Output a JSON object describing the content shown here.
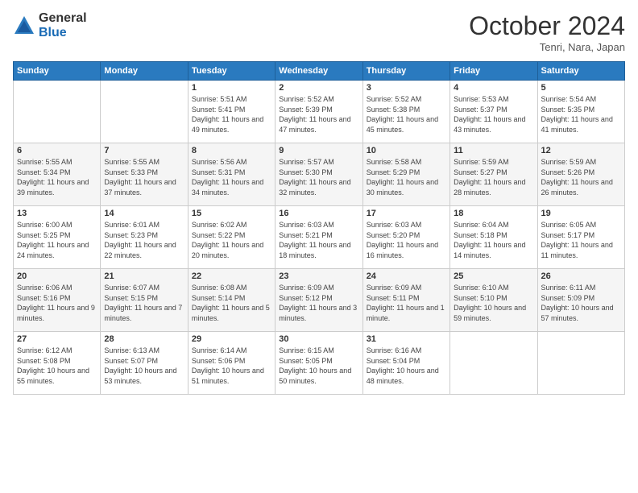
{
  "logo": {
    "general": "General",
    "blue": "Blue"
  },
  "header": {
    "month": "October 2024",
    "location": "Tenri, Nara, Japan"
  },
  "weekdays": [
    "Sunday",
    "Monday",
    "Tuesday",
    "Wednesday",
    "Thursday",
    "Friday",
    "Saturday"
  ],
  "weeks": [
    [
      {
        "day": "",
        "info": ""
      },
      {
        "day": "",
        "info": ""
      },
      {
        "day": "1",
        "info": "Sunrise: 5:51 AM\nSunset: 5:41 PM\nDaylight: 11 hours and 49 minutes."
      },
      {
        "day": "2",
        "info": "Sunrise: 5:52 AM\nSunset: 5:39 PM\nDaylight: 11 hours and 47 minutes."
      },
      {
        "day": "3",
        "info": "Sunrise: 5:52 AM\nSunset: 5:38 PM\nDaylight: 11 hours and 45 minutes."
      },
      {
        "day": "4",
        "info": "Sunrise: 5:53 AM\nSunset: 5:37 PM\nDaylight: 11 hours and 43 minutes."
      },
      {
        "day": "5",
        "info": "Sunrise: 5:54 AM\nSunset: 5:35 PM\nDaylight: 11 hours and 41 minutes."
      }
    ],
    [
      {
        "day": "6",
        "info": "Sunrise: 5:55 AM\nSunset: 5:34 PM\nDaylight: 11 hours and 39 minutes."
      },
      {
        "day": "7",
        "info": "Sunrise: 5:55 AM\nSunset: 5:33 PM\nDaylight: 11 hours and 37 minutes."
      },
      {
        "day": "8",
        "info": "Sunrise: 5:56 AM\nSunset: 5:31 PM\nDaylight: 11 hours and 34 minutes."
      },
      {
        "day": "9",
        "info": "Sunrise: 5:57 AM\nSunset: 5:30 PM\nDaylight: 11 hours and 32 minutes."
      },
      {
        "day": "10",
        "info": "Sunrise: 5:58 AM\nSunset: 5:29 PM\nDaylight: 11 hours and 30 minutes."
      },
      {
        "day": "11",
        "info": "Sunrise: 5:59 AM\nSunset: 5:27 PM\nDaylight: 11 hours and 28 minutes."
      },
      {
        "day": "12",
        "info": "Sunrise: 5:59 AM\nSunset: 5:26 PM\nDaylight: 11 hours and 26 minutes."
      }
    ],
    [
      {
        "day": "13",
        "info": "Sunrise: 6:00 AM\nSunset: 5:25 PM\nDaylight: 11 hours and 24 minutes."
      },
      {
        "day": "14",
        "info": "Sunrise: 6:01 AM\nSunset: 5:23 PM\nDaylight: 11 hours and 22 minutes."
      },
      {
        "day": "15",
        "info": "Sunrise: 6:02 AM\nSunset: 5:22 PM\nDaylight: 11 hours and 20 minutes."
      },
      {
        "day": "16",
        "info": "Sunrise: 6:03 AM\nSunset: 5:21 PM\nDaylight: 11 hours and 18 minutes."
      },
      {
        "day": "17",
        "info": "Sunrise: 6:03 AM\nSunset: 5:20 PM\nDaylight: 11 hours and 16 minutes."
      },
      {
        "day": "18",
        "info": "Sunrise: 6:04 AM\nSunset: 5:18 PM\nDaylight: 11 hours and 14 minutes."
      },
      {
        "day": "19",
        "info": "Sunrise: 6:05 AM\nSunset: 5:17 PM\nDaylight: 11 hours and 11 minutes."
      }
    ],
    [
      {
        "day": "20",
        "info": "Sunrise: 6:06 AM\nSunset: 5:16 PM\nDaylight: 11 hours and 9 minutes."
      },
      {
        "day": "21",
        "info": "Sunrise: 6:07 AM\nSunset: 5:15 PM\nDaylight: 11 hours and 7 minutes."
      },
      {
        "day": "22",
        "info": "Sunrise: 6:08 AM\nSunset: 5:14 PM\nDaylight: 11 hours and 5 minutes."
      },
      {
        "day": "23",
        "info": "Sunrise: 6:09 AM\nSunset: 5:12 PM\nDaylight: 11 hours and 3 minutes."
      },
      {
        "day": "24",
        "info": "Sunrise: 6:09 AM\nSunset: 5:11 PM\nDaylight: 11 hours and 1 minute."
      },
      {
        "day": "25",
        "info": "Sunrise: 6:10 AM\nSunset: 5:10 PM\nDaylight: 10 hours and 59 minutes."
      },
      {
        "day": "26",
        "info": "Sunrise: 6:11 AM\nSunset: 5:09 PM\nDaylight: 10 hours and 57 minutes."
      }
    ],
    [
      {
        "day": "27",
        "info": "Sunrise: 6:12 AM\nSunset: 5:08 PM\nDaylight: 10 hours and 55 minutes."
      },
      {
        "day": "28",
        "info": "Sunrise: 6:13 AM\nSunset: 5:07 PM\nDaylight: 10 hours and 53 minutes."
      },
      {
        "day": "29",
        "info": "Sunrise: 6:14 AM\nSunset: 5:06 PM\nDaylight: 10 hours and 51 minutes."
      },
      {
        "day": "30",
        "info": "Sunrise: 6:15 AM\nSunset: 5:05 PM\nDaylight: 10 hours and 50 minutes."
      },
      {
        "day": "31",
        "info": "Sunrise: 6:16 AM\nSunset: 5:04 PM\nDaylight: 10 hours and 48 minutes."
      },
      {
        "day": "",
        "info": ""
      },
      {
        "day": "",
        "info": ""
      }
    ]
  ]
}
